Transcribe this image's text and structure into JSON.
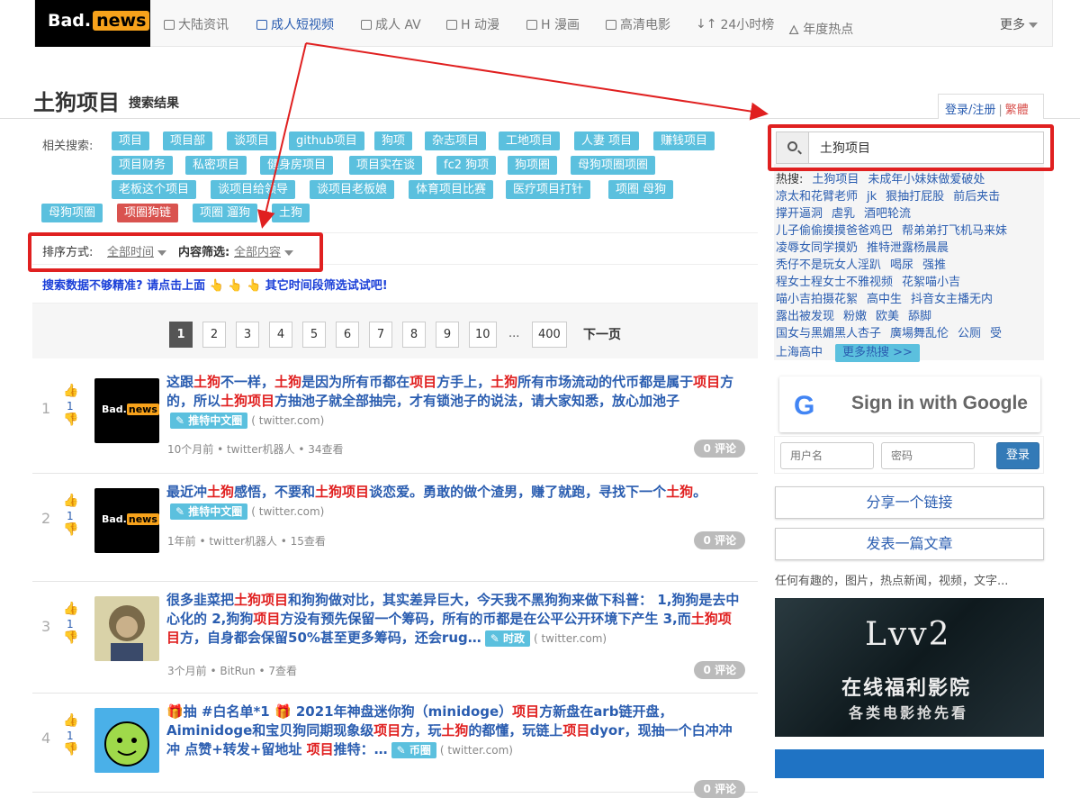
{
  "brand": {
    "logo_text": "Bad.",
    "logo_pill": "news"
  },
  "nav": {
    "items": [
      "大陆资讯",
      "成人短视频",
      "成人 AV",
      "H 动漫",
      "H 漫画",
      "高清电影",
      "24小时榜",
      "年度热点"
    ],
    "more": "更多"
  },
  "header": {
    "title": "土狗项目",
    "subtitle": "搜索结果",
    "login": "登录/注册",
    "traditional": "繁體"
  },
  "related": {
    "label": "相关搜索:",
    "tags": [
      "项目",
      "项目部",
      "谈项目",
      "github项目",
      "狗项",
      "杂志项目",
      "工地项目",
      "人妻 项目",
      "赚钱项目",
      "项目财务",
      "私密项目",
      "健身房项目",
      "项目实在谈",
      "fc2 狗项",
      "狗项圈",
      "母狗项圈项圈",
      "老板这个项目",
      "谈项目给领导",
      "谈项目老板娘",
      "体育项目比赛",
      "医疗项目打针",
      "项圈 母狗",
      "母狗项圈",
      "项圈狗链",
      "项圈 遛狗",
      "土狗"
    ]
  },
  "sort": {
    "label": "排序方式:",
    "value": "全部时间",
    "filter_label": "内容筛选:",
    "filter_value": "全部内容"
  },
  "hint": "搜索数据不够精准?  请点击上面 👆 👆 👆 其它时间段筛选试试吧!",
  "pager": {
    "pages": [
      "1",
      "2",
      "3",
      "4",
      "5",
      "6",
      "7",
      "8",
      "9",
      "10"
    ],
    "dots": "...",
    "last": "400",
    "next": "下一页"
  },
  "results": [
    {
      "num": "1",
      "votes": "1",
      "title_parts": [
        [
          "这跟",
          ""
        ],
        [
          "土狗",
          "hl"
        ],
        [
          "不一样，",
          ""
        ],
        [
          "土狗",
          "hl"
        ],
        [
          "是因为所有币都在",
          ""
        ],
        [
          "项目",
          "hl"
        ],
        [
          "方手上，",
          ""
        ],
        [
          "土狗",
          "hl"
        ],
        [
          "所有市场流动的代币都是属于",
          ""
        ],
        [
          "项目",
          "hl"
        ],
        [
          "方的，所以",
          ""
        ],
        [
          "土狗项目",
          "hl"
        ],
        [
          "方抽池子就全部抽完，才有锁池子的说法，请大家知悉，放心加池子",
          ""
        ]
      ],
      "tag": "推特中文圈",
      "source": "( twitter.com)",
      "meta": "10个月前 • twitter机器人 • 34查看",
      "comments": "0 评论"
    },
    {
      "num": "2",
      "votes": "1",
      "title_parts": [
        [
          "最近冲",
          ""
        ],
        [
          "土狗",
          "hl"
        ],
        [
          "感悟，不要和",
          ""
        ],
        [
          "土狗项目",
          "hl"
        ],
        [
          "谈恋爱。勇敢的做个渣男，赚了就跑，寻找下一个",
          ""
        ],
        [
          "土狗",
          "hl"
        ],
        [
          "。",
          ""
        ]
      ],
      "tag": "推特中文圈",
      "source": "( twitter.com)",
      "meta": "1年前 • twitter机器人 • 15查看",
      "comments": "0 评论"
    },
    {
      "num": "3",
      "votes": "1",
      "title_parts": [
        [
          "很多韭菜把",
          ""
        ],
        [
          "土狗项目",
          "hl"
        ],
        [
          "和狗狗做对比，其实差异巨大，今天我不黑狗狗来做下科普：  1,狗狗是去中心化的 2,狗狗",
          ""
        ],
        [
          "项目",
          "hl"
        ],
        [
          "方没有预先保留一个筹码，所有的币都是在公平公开环境下产生 3,而",
          ""
        ],
        [
          "土狗",
          "hl"
        ],
        [
          "",
          ""
        ],
        [
          "项目",
          "hl"
        ],
        [
          "方，自身都会保留50%甚至更多筹码，还会rug…",
          ""
        ]
      ],
      "tag": "时政",
      "source": "( twitter.com)",
      "meta": "3个月前 • BitRun • 7查看",
      "comments": "0 评论"
    },
    {
      "num": "4",
      "votes": "1",
      "title_parts": [
        [
          "🎁抽 #白名单*1 🎁 2021年神盘迷你狗（minidoge）",
          ""
        ],
        [
          "项目",
          "hl"
        ],
        [
          "方新盘在arb链开盘，Aiminidoge和宝贝狗同期现象级",
          ""
        ],
        [
          "项目",
          "hl"
        ],
        [
          "方，玩",
          ""
        ],
        [
          "土狗",
          "hl"
        ],
        [
          "的都懂，玩链上",
          ""
        ],
        [
          "项目",
          "hl"
        ],
        [
          "dyor，现抽一个白冲冲冲 点赞+转发+留地址 ",
          ""
        ],
        [
          "项目",
          "hl"
        ],
        [
          "推特：…",
          ""
        ]
      ],
      "tag": "币圈",
      "source": "( twitter.com)",
      "meta": "",
      "comments": "0 评论"
    }
  ],
  "search": {
    "value": "土狗项目"
  },
  "hot": {
    "label": "热搜:",
    "lines": [
      [
        "土狗项目",
        "未成年小妹妹做爱破处"
      ],
      [
        "凉太和花臂老师",
        "jk",
        "狠抽打屁股",
        "前后夹击"
      ],
      [
        "撑开逼洞",
        "虐乳",
        "酒吧轮流"
      ],
      [
        "儿子偷偷摸摸爸爸鸡巴",
        "帮弟弟打飞机马来妹"
      ],
      [
        "凌辱女同学摸奶",
        "推特泄露杨晨晨"
      ],
      [
        "秃仔不是玩女人淫趴",
        "喝尿",
        "强推"
      ],
      [
        "程女士程女士不雅视频",
        "花絮喵小吉"
      ],
      [
        "喵小吉拍摄花絮",
        "高中生",
        "抖音女主播无内"
      ],
      [
        "露出被发现",
        "粉嫩",
        "欧美",
        "舔脚"
      ],
      [
        "国女与黑媚黑人杏子",
        "廣場舞乱伦",
        "公厕",
        "受"
      ],
      [
        "上海高中"
      ]
    ],
    "more": "更多热搜 >>"
  },
  "google": {
    "label": "Sign in with Google"
  },
  "login_form": {
    "username_placeholder": "用户名",
    "password_placeholder": "密码",
    "submit": "登录"
  },
  "actions": {
    "share_link": "分享一个链接",
    "post_article": "发表一篇文章",
    "note": "任何有趣的，图片，热点新闻，视频，文字..."
  },
  "ad": {
    "title": "Lvv2",
    "line1": "在线福利影院",
    "line2": "各类电影抢先看"
  },
  "colors": {
    "accent": "#2a5db0",
    "tag": "#5bc0de",
    "highlight": "#e02020",
    "annotation": "#e02020"
  }
}
